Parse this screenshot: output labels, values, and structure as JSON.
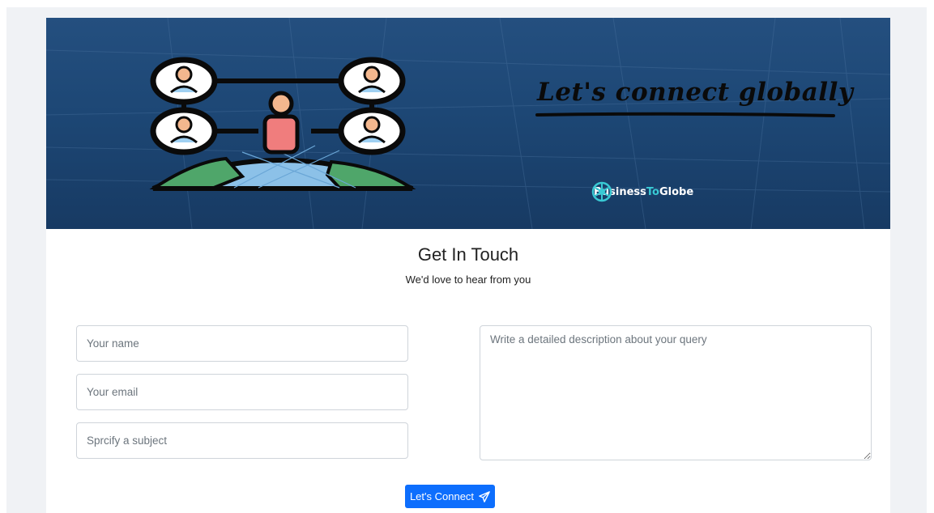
{
  "banner": {
    "title": "Let's connect globally",
    "brand_prefix": "Business",
    "brand_highlight": "To",
    "brand_suffix": "Globe",
    "brand_icon": "globe-network-icon",
    "illustration_icon": "global-network-people-icon"
  },
  "contact": {
    "heading": "Get In Touch",
    "subtitle": "We'd love to hear from you"
  },
  "form": {
    "name_placeholder": "Your name",
    "email_placeholder": "Your email",
    "subject_placeholder": "Sprcify a subject",
    "message_placeholder": "Write a detailed description about your query",
    "submit_label": "Let's Connect",
    "submit_icon": "send-icon"
  },
  "colors": {
    "banner_blue": "#1d4775",
    "button_blue": "#0d6efd",
    "brand_accent": "#39c9d4"
  }
}
